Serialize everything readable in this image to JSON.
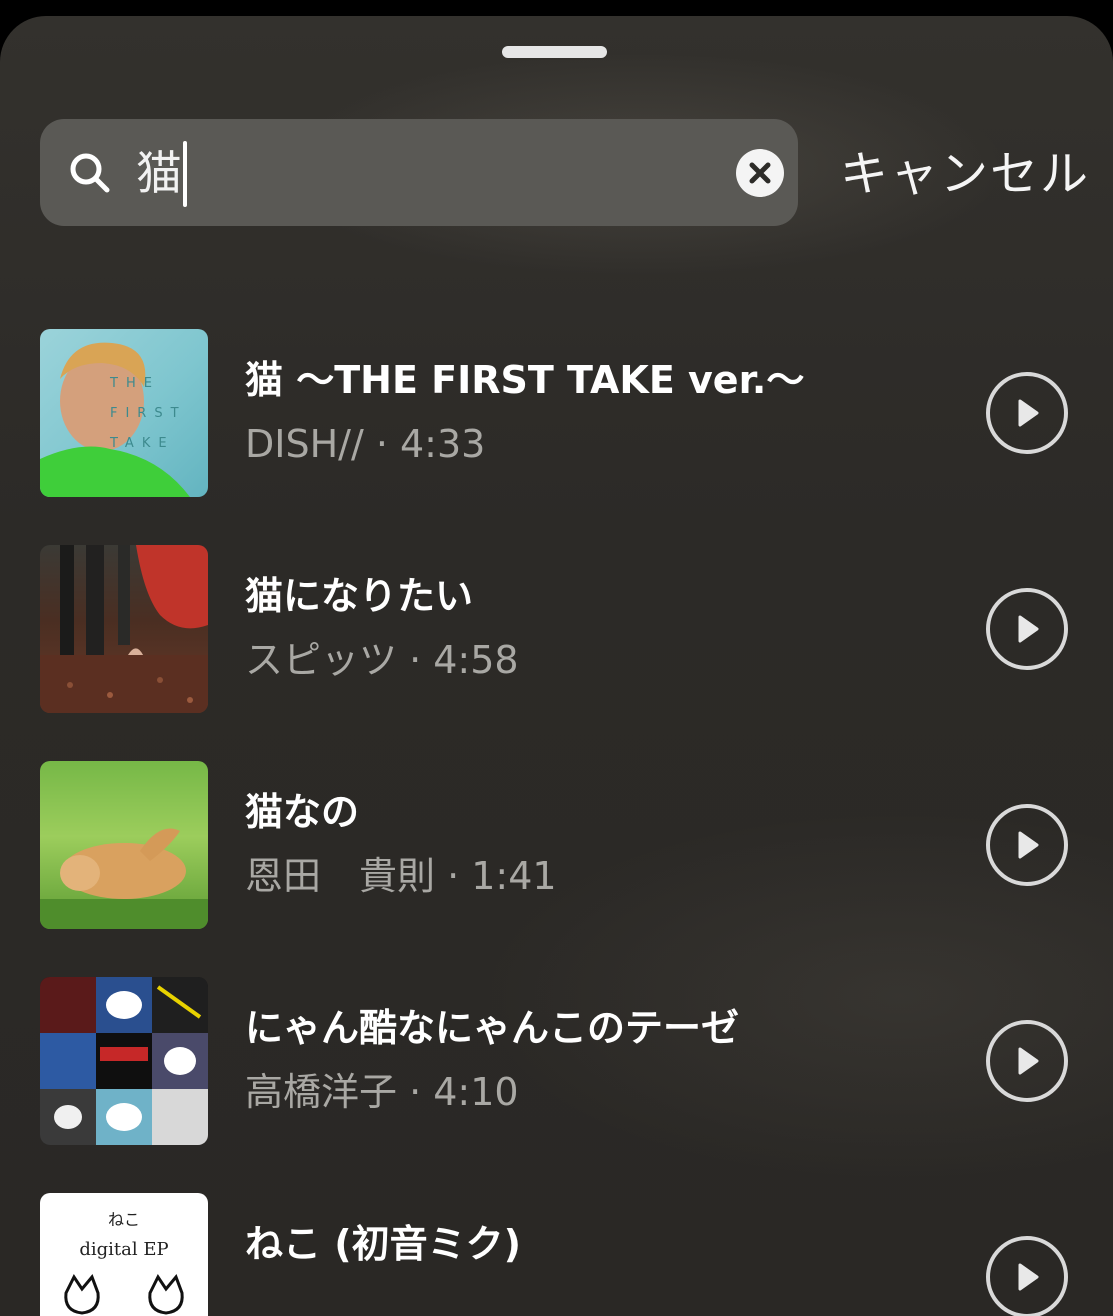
{
  "search": {
    "query": "猫",
    "cancel_label": "キャンセル"
  },
  "results": [
    {
      "title": "猫 〜THE FIRST TAKE ver.〜",
      "subtitle": "DISH// · 4:33",
      "art_text": "T H E  F I R S T  T A K E"
    },
    {
      "title": "猫になりたい",
      "subtitle": "スピッツ · 4:58"
    },
    {
      "title": "猫なの",
      "subtitle": "恩田　貴則 · 1:41"
    },
    {
      "title": "にゃん酷なにゃんこのテーゼ",
      "subtitle": "高橋洋子 · 4:10"
    },
    {
      "title": "ねこ (初音ミク)",
      "subtitle": "",
      "art_text_1": "ねこ",
      "art_text_2": "digital EP"
    }
  ],
  "colors": {
    "background": "#2c2a27",
    "search_bar": "#5a5955",
    "title": "#ffffff",
    "subtitle": "#a9a8a4",
    "play_ring": "#d9d9d9"
  },
  "icons": {
    "search": "search-icon",
    "clear": "clear-icon",
    "play": "play-icon"
  }
}
